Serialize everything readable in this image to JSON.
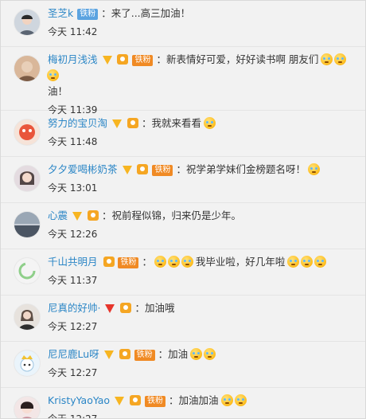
{
  "comments": [
    {
      "user": "圣芝k",
      "tag": "铁粉",
      "text": "：来了...高三加油！",
      "time": "今天 11:42"
    },
    {
      "user": "梅初月浅浅",
      "tag": "铁粉",
      "text": "：新表情好可爱，好好读书啊 朋友们",
      "text2": "油！",
      "time": "今天 11:39"
    },
    {
      "user": "努力的宝贝淘",
      "text": "：我就来看看",
      "time": "今天 11:48"
    },
    {
      "user": "夕夕爱喝彬奶茶",
      "tag": "铁粉",
      "text": "：祝学弟学妹们金榜题名呀！",
      "time": "今天 13:01"
    },
    {
      "user": "心震",
      "text": "：祝前程似锦，归来仍是少年。",
      "time": "今天 12:26"
    },
    {
      "user": "千山共明月",
      "tag": "铁粉",
      "text": "：",
      "text2": "我毕业啦，好几年啦",
      "time": "今天 11:37"
    },
    {
      "user": "尼真的好帅·",
      "text": "：加油哦",
      "time": "今天 12:27"
    },
    {
      "user": "尼尼鹿Lu呀",
      "tag": "铁粉",
      "text": "：加油",
      "time": "今天 12:27"
    },
    {
      "user": "KristyYaoYao",
      "tag": "铁粉",
      "text": "：加油加油",
      "time": "今天 12:27"
    }
  ],
  "colors": {
    "username": "#2b86c6",
    "fan_tag": "#f08a24",
    "vip_badge": "#f7b521"
  }
}
